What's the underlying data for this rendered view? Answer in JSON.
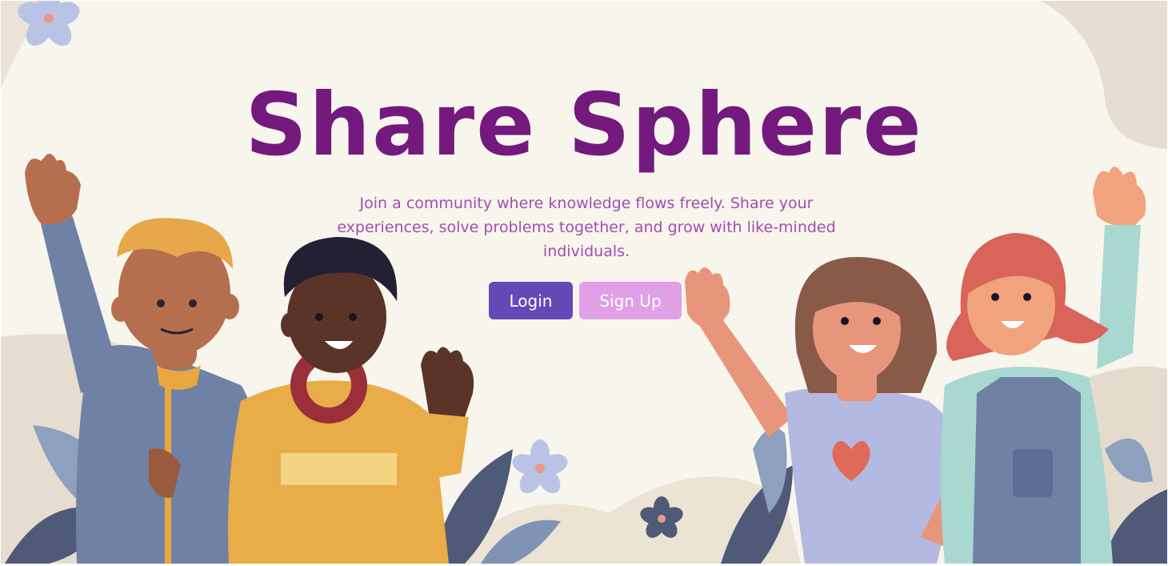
{
  "hero": {
    "title": "Share Sphere",
    "tagline": "Join a community where knowledge flows freely. Share your experiences, solve problems together, and grow with like-minded individuals."
  },
  "buttons": {
    "login_label": "Login",
    "signup_label": "Sign Up"
  },
  "colors": {
    "background": "#f8f5ec",
    "title": "#741a7e",
    "tagline": "#a64bb4",
    "login_button": "#6449b6",
    "signup_button": "#dfa0e6"
  },
  "illustration": {
    "people": [
      "waving-man-turban",
      "smiling-boy-headphones",
      "waving-woman-heart-shirt",
      "waving-girl-red-hair"
    ],
    "decor": [
      "flower-icon",
      "leaf-icon"
    ]
  }
}
